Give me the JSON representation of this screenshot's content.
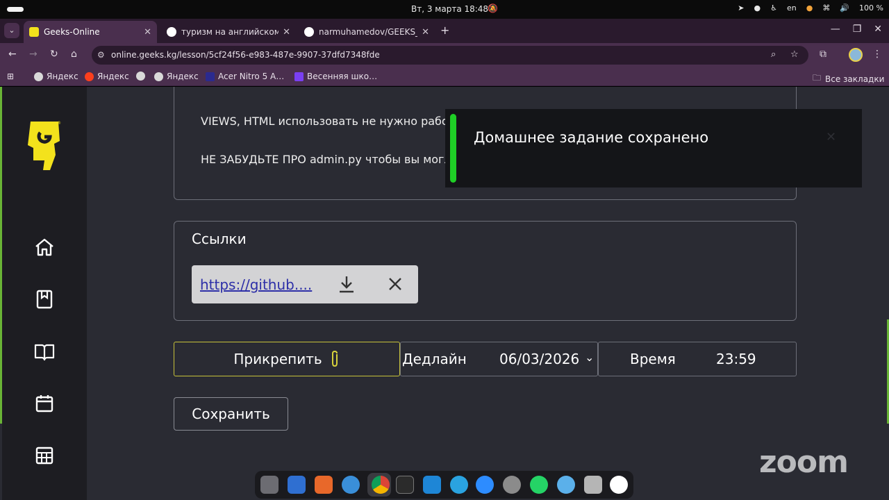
{
  "system": {
    "clock": "Вт, 3 марта  18:48",
    "language": "en",
    "battery": "100 %"
  },
  "browser": {
    "tabs": [
      {
        "title": "Geeks-Online",
        "active": true,
        "favicon_color": "#f3e21c"
      },
      {
        "title": "туризм на английском -",
        "active": false,
        "favicon_color": "#4285f4"
      },
      {
        "title": "narmuhamedov/GEEKS_",
        "active": false,
        "favicon_color": "#ffffff"
      }
    ],
    "url": "online.geeks.kg/lesson/5cf24f56-e983-487e-9907-37dfd7348fde",
    "bookmarks": [
      {
        "label": "Яндекс",
        "icon_color": "#d9d9d9"
      },
      {
        "label": "Яндекс",
        "icon_color": "#fc3f1d"
      },
      {
        "label": "",
        "icon_color": "#d9d9d9"
      },
      {
        "label": "Яндекс",
        "icon_color": "#d9d9d9"
      },
      {
        "label": "Acer Nitro 5 A…",
        "icon_color": "#2b2a8f"
      },
      {
        "label": "Весенняя шко…",
        "icon_color": "#7a3ff2"
      }
    ],
    "all_bookmarks": "Все закладки"
  },
  "sidebar": {
    "items": [
      {
        "icon": "home-icon"
      },
      {
        "icon": "bookmark-icon"
      },
      {
        "icon": "book-open-icon"
      },
      {
        "icon": "calendar-icon"
      },
      {
        "icon": "table-icon"
      }
    ]
  },
  "lesson": {
    "description_lines": [
      "VIEWS, HTML использовать не нужно работ",
      "НЕ ЗАБУДЬТЕ ПРО admin.py чтобы вы могл"
    ],
    "links_title": "Ссылки",
    "link_text": "https://github....",
    "attach_label": "Прикрепить",
    "deadline_label": "Дедлайн",
    "deadline_value": "06/03/2026",
    "time_label": "Время",
    "time_value": "23:59",
    "save_label": "Сохранить"
  },
  "toast": {
    "message": "Домашнее задание сохранено",
    "accent": "#1fcf26"
  },
  "watermark": "zoom",
  "colors": {
    "page_bg": "#2a2b33",
    "sidebar_bg": "#1d1d22",
    "brand_yellow": "#f3e21c",
    "chrome_frame": "#4a2f4e"
  }
}
